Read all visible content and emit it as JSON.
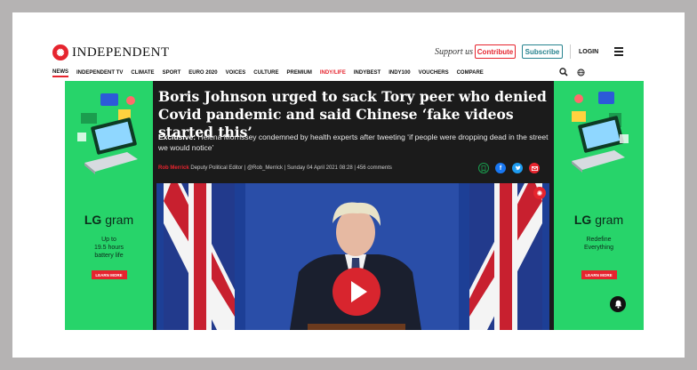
{
  "header": {
    "logo_text": "INDEPENDENT",
    "logo_mark": "✺",
    "support_text": "Support us",
    "contribute_label": "Contribute",
    "subscribe_label": "Subscribe",
    "login_label": "LOGIN"
  },
  "nav": {
    "items": [
      "NEWS",
      "INDEPENDENT TV",
      "CLIMATE",
      "SPORT",
      "EURO 2020",
      "VOICES",
      "CULTURE",
      "PREMIUM",
      "INDY/LIFE",
      "INDYBEST",
      "INDY100",
      "VOUCHERS",
      "COMPARE"
    ],
    "active": "NEWS"
  },
  "ad_left": {
    "brand_prefix": "LG",
    "brand_suffix": "gram",
    "copy_lines": [
      "Up to",
      "19.5 hours",
      "battery life"
    ],
    "cta": "LEARN MORE"
  },
  "ad_right": {
    "brand_prefix": "LG",
    "brand_suffix": "gram",
    "copy_lines": [
      "Redefine",
      "Everything"
    ],
    "cta": "LEARN MORE"
  },
  "article": {
    "headline": "Boris Johnson urged to sack Tory peer who denied Covid pandemic and said Chinese ‘fake videos started this’",
    "standfirst_label": "Exclusive:",
    "standfirst_text": " Helena Morrissey condemned by health experts after tweeting ‘if people were dropping dead in the street we would notice’",
    "author": "Rob Merrick",
    "byline_rest": " Deputy Political Editor | @Rob_Merrick | Sunday 04 April 2021 08:28 | 456 comments"
  },
  "colors": {
    "brand_red": "#e6242e",
    "subscribe_teal": "#27838f",
    "ad_green": "#27d46a",
    "facebook": "#1877f2",
    "twitter": "#1d9bf0"
  }
}
